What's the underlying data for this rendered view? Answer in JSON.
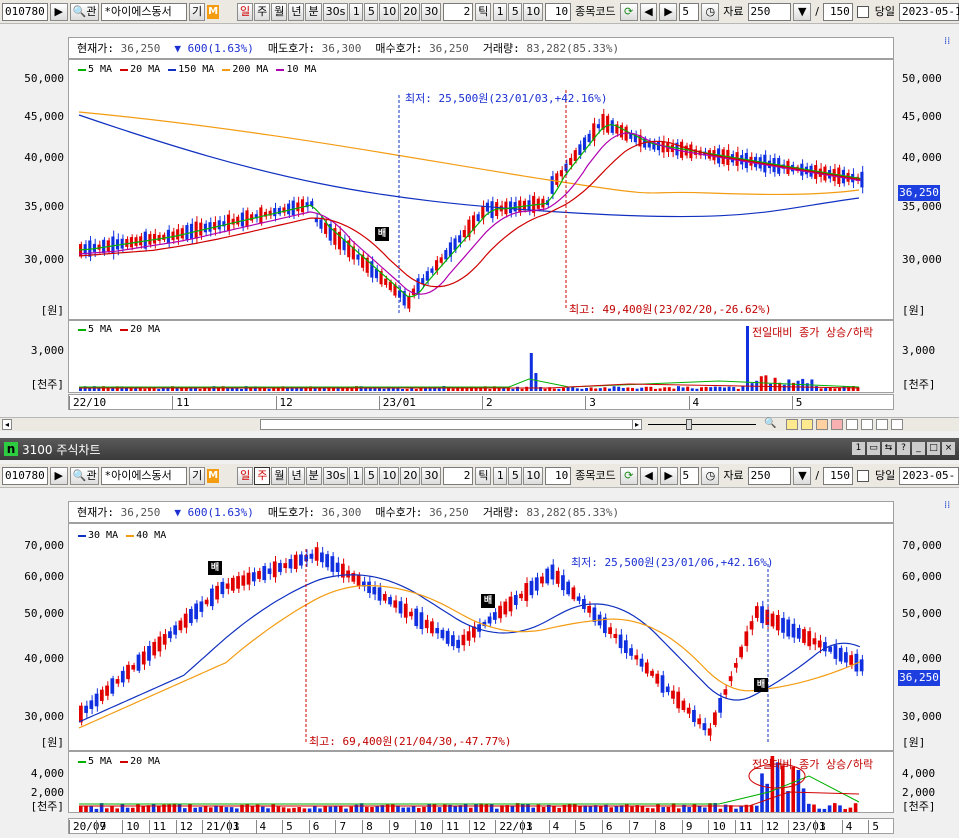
{
  "colors": {
    "up": "#e00000",
    "down": "#1030e0",
    "ma5": "#00b000",
    "ma20": "#d00000",
    "ma150": "#1030c0",
    "ma200": "#f39c12",
    "ma10": "#b000b0",
    "ma30": "#1030c0",
    "ma40": "#f39c12",
    "price_tag": "#1e3fe0"
  },
  "toolbar1": {
    "code": "010780",
    "search_label": "관",
    "name": "*아이에스동서",
    "gi_label": "기",
    "m_label": "M",
    "periods": [
      "일",
      "주",
      "월",
      "년",
      "분",
      "30s",
      "1",
      "5",
      "10",
      "20",
      "30"
    ],
    "tick_value": "2",
    "tick_label": "틱",
    "tick_options": [
      "1",
      "5",
      "10"
    ],
    "tick_extra": "10",
    "stock_code_label": "종목코드",
    "step_value": "5",
    "data_label": "자료",
    "data_count": "250",
    "slash": "/",
    "total": "150",
    "today_label": "당일",
    "date_value": "2023-05-1"
  },
  "chart1": {
    "info": {
      "cur_label": "현재가:",
      "cur": "36,250",
      "chg_label": "600(1.63%)",
      "ask_label": "매도호가:",
      "ask": "36,300",
      "bid_label": "매수호가:",
      "bid": "36,250",
      "vol_label": "거래량:",
      "vol": "83,282(85.33%)"
    },
    "legend": [
      {
        "name": "5 MA",
        "color": "#00b000"
      },
      {
        "name": "20 MA",
        "color": "#d00000"
      },
      {
        "name": "150 MA",
        "color": "#1030c0"
      },
      {
        "name": "200 MA",
        "color": "#f39c12"
      },
      {
        "name": "10 MA",
        "color": "#b000b0"
      }
    ],
    "y_ticks": [
      "50,000",
      "45,000",
      "40,000",
      "35,000",
      "30,000"
    ],
    "unit": "[원]",
    "low_note": "최저: 25,500원(23/01/03,+42.16%)",
    "high_note": "최고: 49,400원(23/02/20,-26.62%)",
    "price_tag": "36,250",
    "signal": "배",
    "vol_legend": [
      {
        "name": "5 MA",
        "color": "#00b000"
      },
      {
        "name": "20 MA",
        "color": "#d00000"
      }
    ],
    "vol_note": "전일대비 종가 상승/하락",
    "vol_tick": "3,000",
    "vol_unit": "[천주]",
    "dates": [
      "22/10",
      "11",
      "12",
      "23/01",
      "2",
      "3",
      "4",
      "5"
    ]
  },
  "window2": {
    "title": "3100 주식차트",
    "icon": "n"
  },
  "toolbar2": {
    "code": "010780",
    "search_label": "관",
    "name": "*아이에스동서",
    "gi_label": "기",
    "m_label": "M",
    "periods": [
      "일",
      "주",
      "월",
      "년",
      "분",
      "30s",
      "1",
      "5",
      "10",
      "20",
      "30"
    ],
    "tick_value": "2",
    "tick_label": "틱",
    "tick_options": [
      "1",
      "5",
      "10"
    ],
    "tick_extra": "10",
    "stock_code_label": "종목코드",
    "step_value": "5",
    "data_label": "자료",
    "data_count": "250",
    "slash": "/",
    "total": "150",
    "today_label": "당일",
    "date_value": "2023-05-"
  },
  "chart2": {
    "info": {
      "cur_label": "현재가:",
      "cur": "36,250",
      "chg_label": "600(1.63%)",
      "ask_label": "매도호가:",
      "ask": "36,300",
      "bid_label": "매수호가:",
      "bid": "36,250",
      "vol_label": "거래량:",
      "vol": "83,282(85.33%)"
    },
    "legend": [
      {
        "name": "30 MA",
        "color": "#1030c0"
      },
      {
        "name": "40 MA",
        "color": "#f39c12"
      }
    ],
    "y_ticks": [
      "70,000",
      "60,000",
      "50,000",
      "40,000",
      "30,000"
    ],
    "unit": "[원]",
    "low_note": "최저: 25,500원(23/01/06,+42.16%)",
    "high_note": "최고: 69,400원(21/04/30,-47.77%)",
    "price_tag": "36,250",
    "signal": "배",
    "vol_legend": [
      {
        "name": "5 MA",
        "color": "#00b000"
      },
      {
        "name": "20 MA",
        "color": "#d00000"
      }
    ],
    "vol_note": "전일대비 종가 상승/하락",
    "vol_ticks": [
      "4,000",
      "2,000"
    ],
    "vol_unit": "[천주]",
    "dates": [
      "20/07",
      "9",
      "10",
      "11",
      "12",
      "21/01",
      "3",
      "4",
      "5",
      "6",
      "7",
      "8",
      "9",
      "10",
      "11",
      "12",
      "22/01",
      "3",
      "4",
      "5",
      "6",
      "7",
      "8",
      "9",
      "10",
      "11",
      "12",
      "23/01",
      "3",
      "4",
      "5"
    ]
  }
}
